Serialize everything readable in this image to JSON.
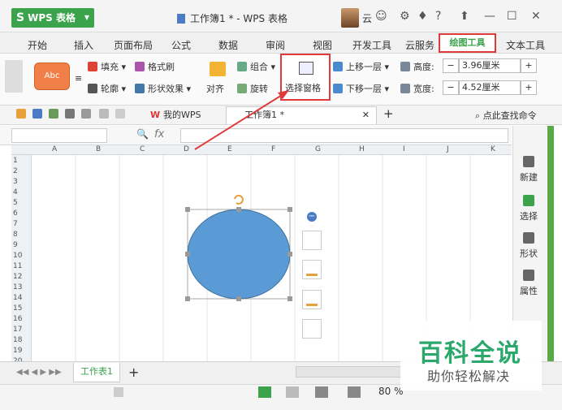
{
  "app": {
    "name": "WPS 表格",
    "doc_title": "工作簿1 * - WPS 表格",
    "user": "云"
  },
  "ribbon_tabs": [
    "开始",
    "插入",
    "页面布局",
    "公式",
    "数据",
    "审阅",
    "视图",
    "开发工具",
    "云服务",
    "绘图工具",
    "文本工具"
  ],
  "ribbon": {
    "style_sample": "Abc",
    "fill": "填充",
    "format_painter": "格式刷",
    "outline": "轮廓",
    "shape_effects": "形状效果",
    "align": "对齐",
    "group": "组合",
    "rotate": "旋转",
    "selection_pane": "选择窗格",
    "bring_forward": "上移一层",
    "send_backward": "下移一层",
    "height_label": "高度:",
    "height_value": "3.96厘米",
    "width_label": "宽度:",
    "width_value": "4.52厘米",
    "minus": "−",
    "plus": "+"
  },
  "quickbar": {
    "wps_tab": "我的WPS",
    "doc_tab": "工作簿1 *",
    "find": "点此查找命令"
  },
  "formula_bar": {
    "fx": "fx"
  },
  "columns": [
    "A",
    "B",
    "C",
    "D",
    "E",
    "F",
    "G",
    "H",
    "I",
    "J",
    "K"
  ],
  "rows": [
    "1",
    "2",
    "3",
    "4",
    "5",
    "6",
    "7",
    "8",
    "9",
    "10",
    "11",
    "12",
    "13",
    "14",
    "15",
    "16",
    "17",
    "18",
    "19",
    "20"
  ],
  "right_panel": [
    "新建",
    "选择",
    "形状",
    "属性"
  ],
  "sheet_tab": "工作表1",
  "status": {
    "zoom": "80 %"
  },
  "watermark": {
    "title": "百科全说",
    "subtitle": "助你轻松解决"
  },
  "colors": {
    "accent": "#3aa34c",
    "highlight": "#e03a3a",
    "shape": "#5b9bd5"
  }
}
